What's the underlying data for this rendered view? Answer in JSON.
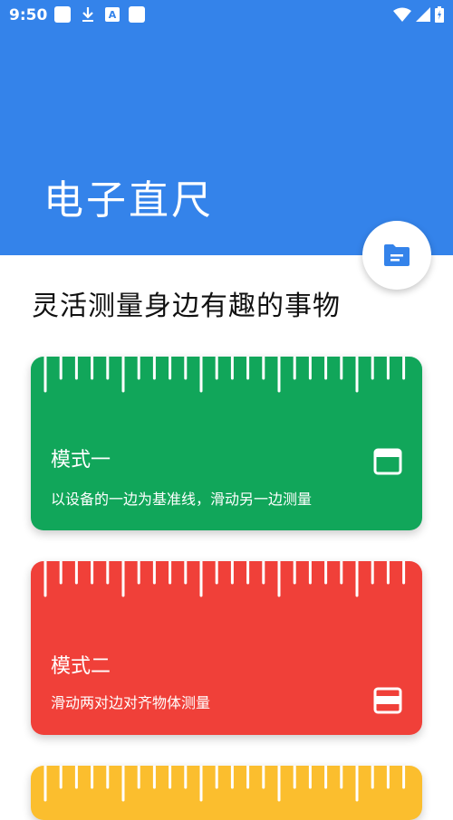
{
  "status_bar": {
    "time": "9:50",
    "a_icon_text": "A"
  },
  "header": {
    "title": "电子直尺",
    "color": "#3483EA"
  },
  "fab": {
    "icon": "folder-icon"
  },
  "subtitle": "灵活测量身边有趣的事物",
  "cards": [
    {
      "title": "模式一",
      "description": "以设备的一边为基准线，滑动另一边测量",
      "color": "#11A65A",
      "icon": "window-top-bar-icon"
    },
    {
      "title": "模式二",
      "description": "滑动两对边对齐物体测量",
      "color": "#F04039",
      "icon": "window-middle-bar-icon"
    },
    {
      "color": "#FBBE2E"
    }
  ]
}
